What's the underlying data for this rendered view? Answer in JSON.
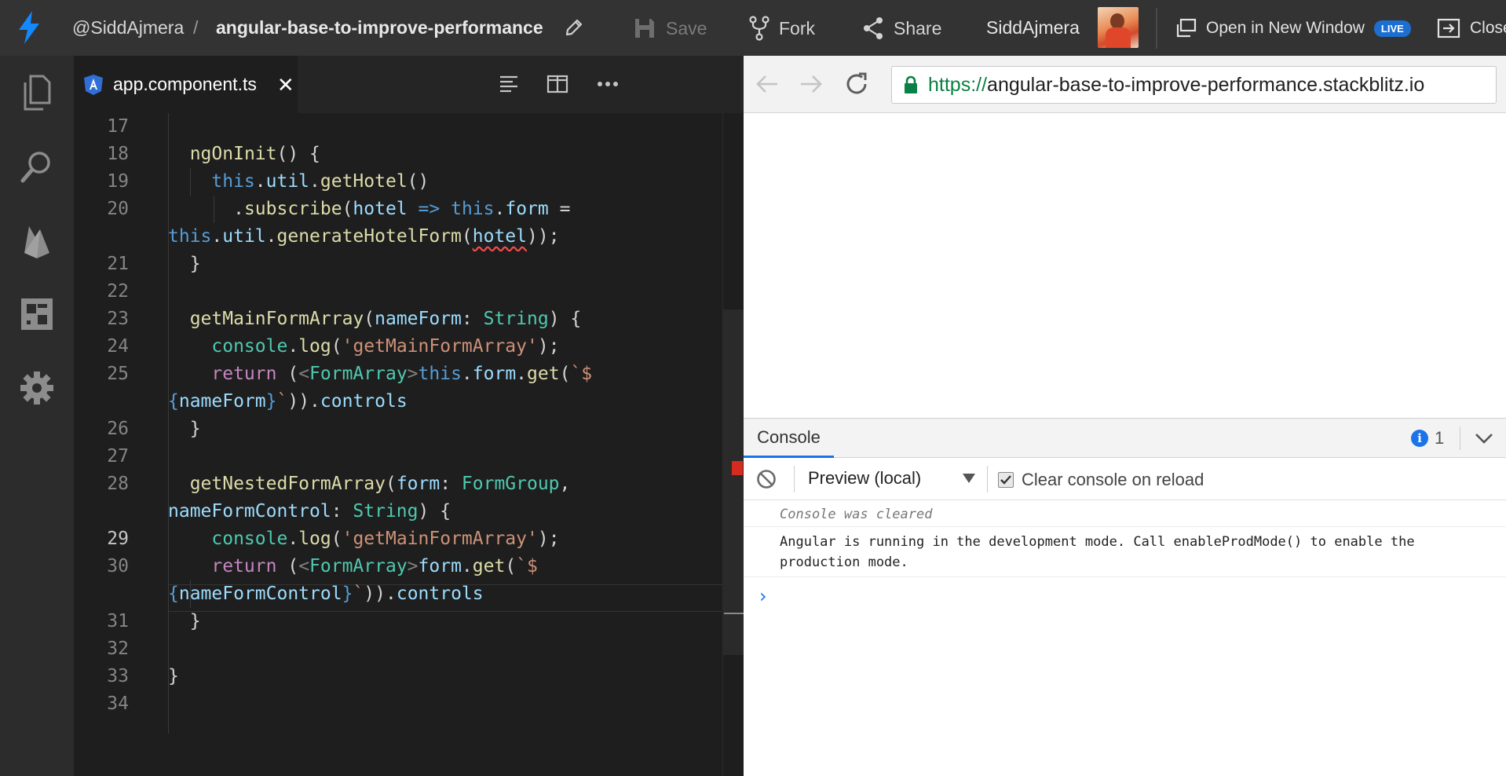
{
  "topbar": {
    "owner": "@SiddAjmera",
    "separator": "/",
    "project": "angular-base-to-improve-performance",
    "save_label": "Save",
    "fork_label": "Fork",
    "share_label": "Share",
    "username": "SiddAjmera",
    "open_new_label": "Open in New Window",
    "live_badge": "LIVE",
    "close_label": "Close"
  },
  "activity_icons": [
    "files-icon",
    "search-icon",
    "firebase-icon",
    "extensions-icon",
    "settings-icon"
  ],
  "editor": {
    "tab_label": "app.component.ts",
    "tab_close": "✕"
  },
  "code": {
    "line_numbers": [
      "17",
      "18",
      "19",
      "20",
      "21",
      "22",
      "23",
      "24",
      "25",
      "26",
      "27",
      "28",
      "29",
      "30",
      "31",
      "32",
      "33",
      "34"
    ],
    "active_line": "29"
  },
  "preview": {
    "url_scheme": "https://",
    "url_host": "angular-base-to-improve-performance.stackblitz.io"
  },
  "console": {
    "tab_label": "Console",
    "info_count": "1",
    "info_symbol": "i",
    "context_label": "Preview (local)",
    "clear_on_reload_label": "Clear console on reload",
    "clear_on_reload_checked": true,
    "messages": [
      "Console was cleared",
      "Angular is running in the development mode. Call enableProdMode() to enable the production mode."
    ],
    "prompt": "›"
  },
  "colors": {
    "accent": "#1a73e8",
    "bolt": "#1389fd",
    "error": "#d62b1f"
  }
}
